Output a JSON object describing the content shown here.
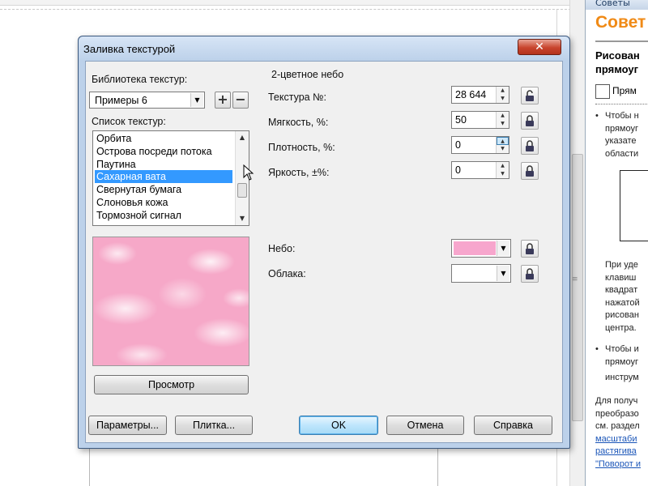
{
  "hints_panel": {
    "header": "Советы",
    "title": "Совет",
    "heading_lines": [
      "Рисован",
      "прямоуг"
    ],
    "tool_label": "Прям",
    "text_lines": [
      "Чтобы н",
      "прямоуг",
      "указате",
      "области"
    ],
    "text_lines_2": [
      "При уде",
      "клавиш",
      "квадрат",
      "нажатой",
      "рисован",
      "центра."
    ],
    "text_lines_3": [
      "Чтобы и",
      "прямоуг",
      "инструм"
    ],
    "text_lines_4": [
      "Для получ",
      "преобразо",
      "см. раздел"
    ],
    "links": [
      "масштаби",
      "растягива",
      "\"Поворот и"
    ]
  },
  "dialog": {
    "title": "Заливка текстурой",
    "close_glyph": "✕",
    "library_label": "Библиотека текстур:",
    "library_value": "Примеры 6",
    "add_glyph": "+",
    "remove_glyph": "−",
    "list_label": "Список текстур:",
    "textures": [
      "Орбита",
      "Острова посреди потока",
      "Паутина",
      "Сахарная вата",
      "Свернутая бумага",
      "Слоновья кожа",
      "Тормозной сигнал"
    ],
    "selected_index": 3,
    "preview_button": "Просмотр",
    "section_label": "2-цветное небо",
    "fields": [
      {
        "label": "Текстура №:",
        "value": "28 644"
      },
      {
        "label": "Мягкость, %:",
        "value": "50"
      },
      {
        "label": "Плотность, %:",
        "value": "0"
      },
      {
        "label": "Яркость, ±%:",
        "value": "0"
      }
    ],
    "colors": [
      {
        "label": "Небо:",
        "color": "#f7a6cd"
      },
      {
        "label": "Облака:",
        "color": "#ffffff"
      }
    ],
    "buttons": {
      "params": "Параметры...",
      "tile": "Плитка...",
      "ok": "OK",
      "cancel": "Отмена",
      "help": "Справка"
    }
  }
}
